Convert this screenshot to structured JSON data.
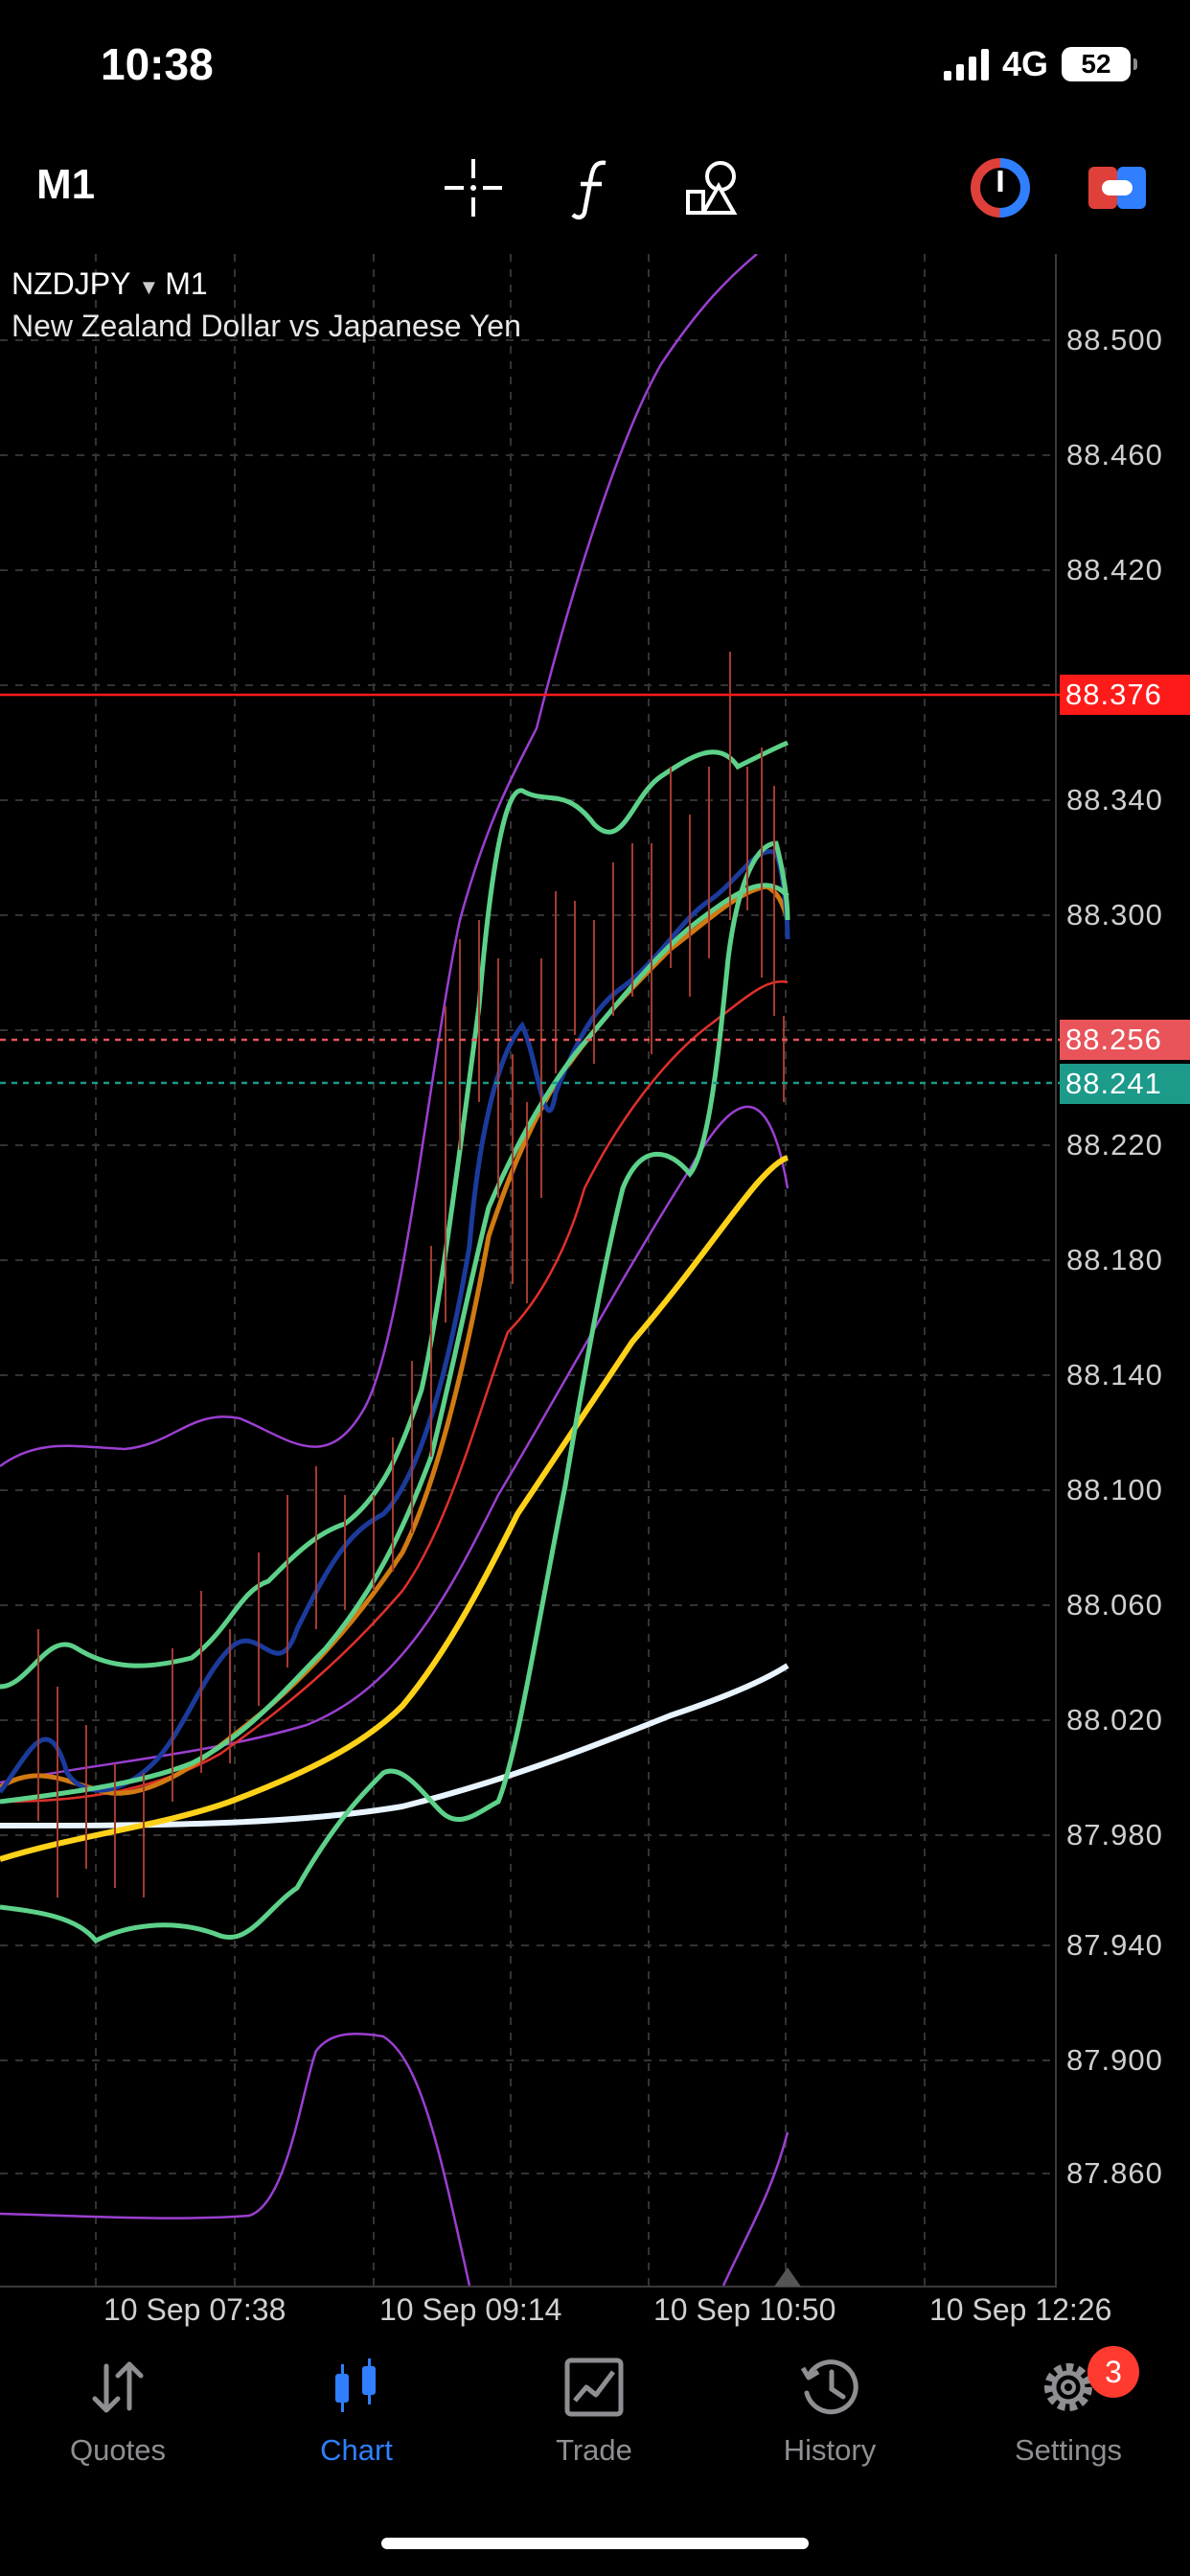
{
  "status_bar": {
    "time": "10:38",
    "network": "4G",
    "battery": "52"
  },
  "toolbar": {
    "timeframe": "M1"
  },
  "chart": {
    "symbol": "NZDJPY",
    "symbol_timeframe": "M1",
    "description": "New Zealand Dollar vs Japanese Yen",
    "price_axis": [
      "88.500",
      "88.460",
      "88.420",
      "88.340",
      "88.300",
      "88.220",
      "88.180",
      "88.140",
      "88.100",
      "88.060",
      "88.020",
      "87.980",
      "87.940",
      "87.900",
      "87.860"
    ],
    "price_tags": {
      "red_line": "88.376",
      "bid": "88.256",
      "ask": "88.241"
    },
    "time_axis": [
      "10 Sep 07:38",
      "10 Sep 09:14",
      "10 Sep 10:50",
      "10 Sep 12:26"
    ],
    "colors": {
      "red_line": "#ff1a1a",
      "bid_tag": "#e8545a",
      "ask_tag": "#1c9a8a",
      "accent": "#2f7fff"
    }
  },
  "nav": {
    "items": [
      {
        "label": "Quotes",
        "icon": "quotes-arrows-icon"
      },
      {
        "label": "Chart",
        "icon": "chart-candles-icon",
        "active": true
      },
      {
        "label": "Trade",
        "icon": "trade-chart-icon"
      },
      {
        "label": "History",
        "icon": "history-clock-icon"
      },
      {
        "label": "Settings",
        "icon": "settings-gear-icon"
      }
    ],
    "settings_badge": "3"
  }
}
